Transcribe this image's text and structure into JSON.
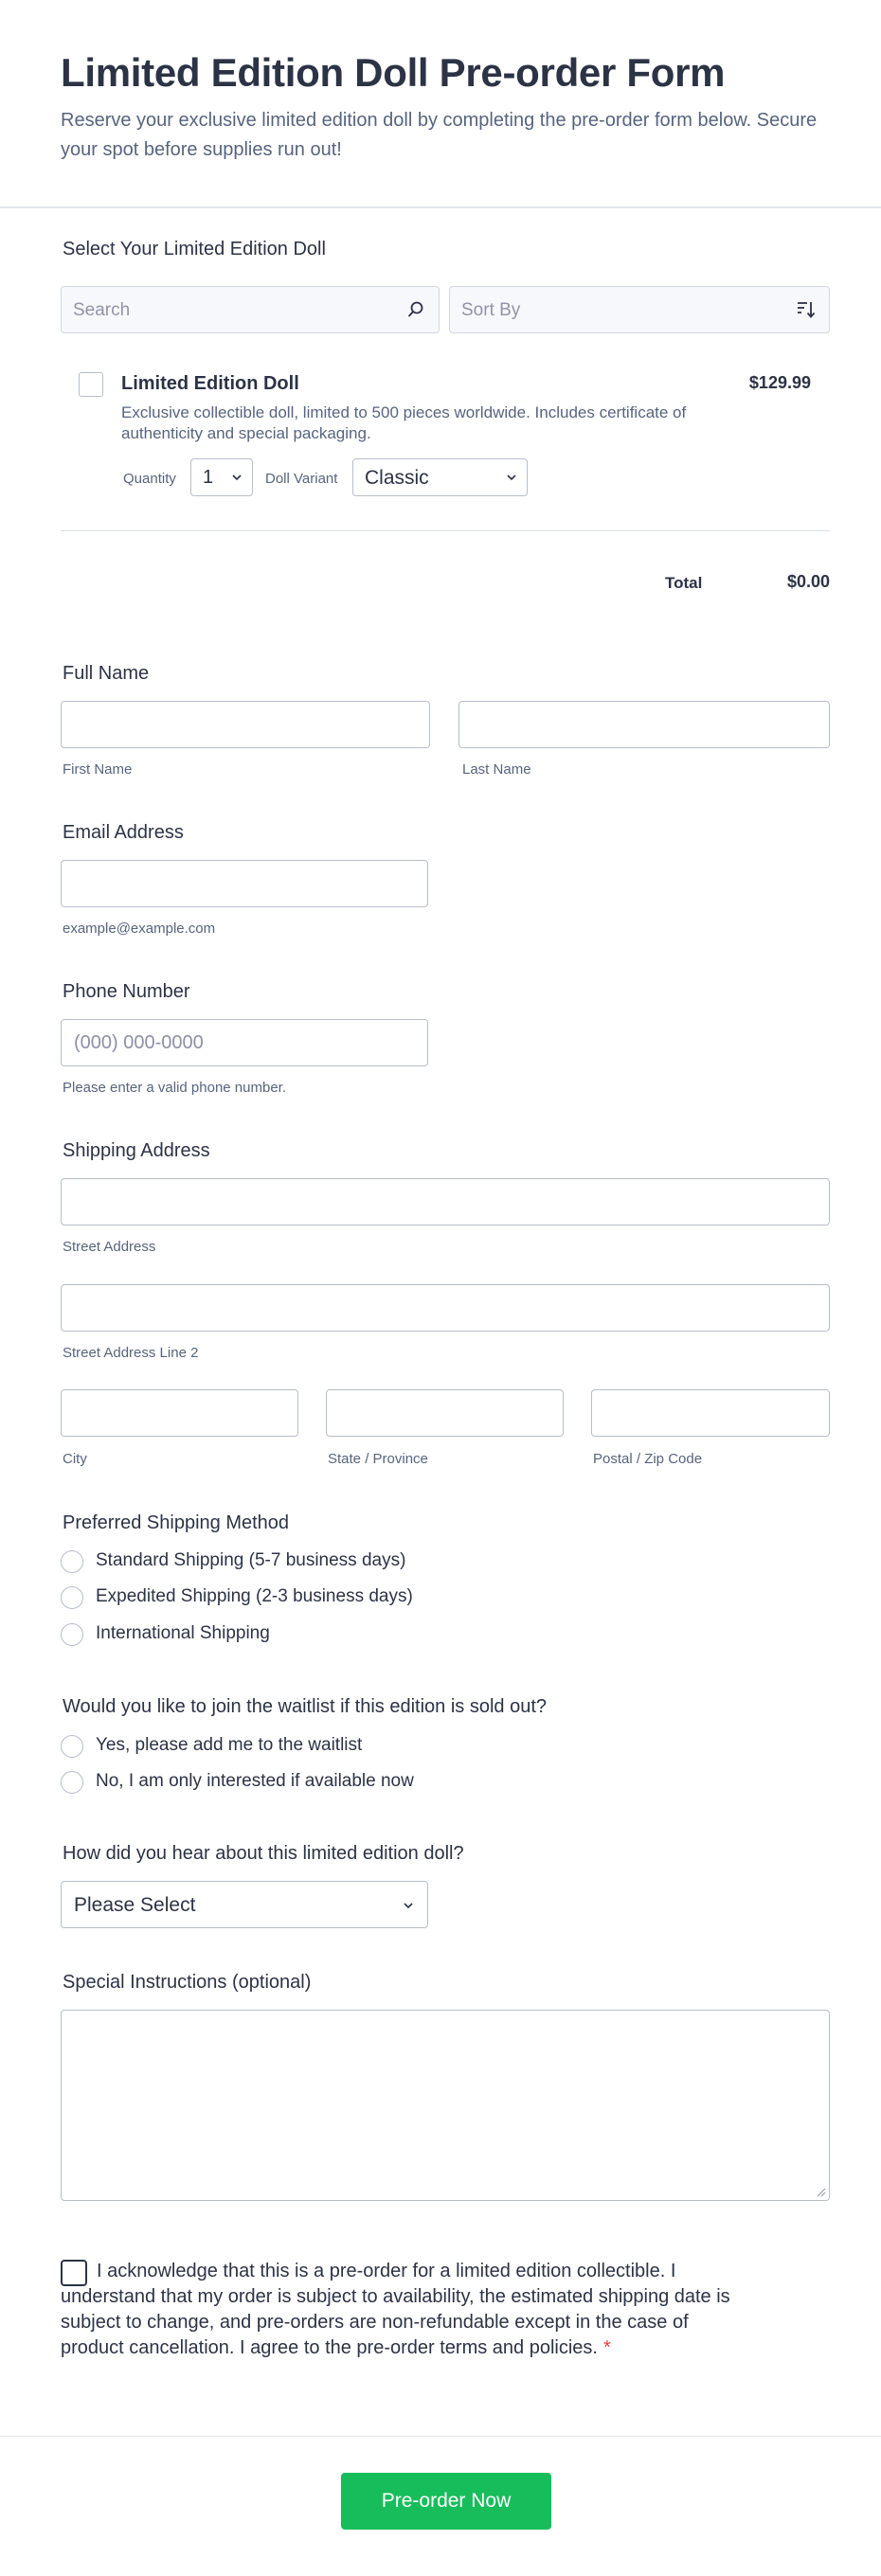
{
  "header": {
    "title": "Limited Edition Doll Pre-order Form",
    "subtitle": "Reserve your exclusive limited edition doll by completing the pre-order form below. Secure your spot before supplies run out!"
  },
  "products": {
    "label": "Select Your Limited Edition Doll",
    "search_placeholder": "Search",
    "sort_placeholder": "Sort By",
    "items": [
      {
        "name": "Limited Edition Doll",
        "price": "$129.99",
        "description": "Exclusive collectible doll, limited to 500 pieces worldwide. Includes certificate of authenticity and special packaging.",
        "quantity_label": "Quantity",
        "quantity_value": "1",
        "variant_label": "Doll Variant",
        "variant_value": "Classic"
      }
    ],
    "total_label": "Total",
    "total_value": "$0.00"
  },
  "full_name": {
    "label": "Full Name",
    "first_sublabel": "First Name",
    "last_sublabel": "Last Name"
  },
  "email": {
    "label": "Email Address",
    "sublabel": "example@example.com"
  },
  "phone": {
    "label": "Phone Number",
    "placeholder": "(000) 000-0000",
    "sublabel": "Please enter a valid phone number."
  },
  "address": {
    "label": "Shipping Address",
    "street_sublabel": "Street Address",
    "street2_sublabel": "Street Address Line 2",
    "city_sublabel": "City",
    "state_sublabel": "State / Province",
    "zip_sublabel": "Postal / Zip Code"
  },
  "shipping_method": {
    "label": "Preferred Shipping Method",
    "options": [
      "Standard Shipping (5-7 business days)",
      "Expedited Shipping (2-3 business days)",
      "International Shipping"
    ]
  },
  "waitlist": {
    "label": "Would you like to join the waitlist if this edition is sold out?",
    "options": [
      "Yes, please add me to the waitlist",
      "No, I am only interested if available now"
    ]
  },
  "referral": {
    "label": "How did you hear about this limited edition doll?",
    "value": "Please Select"
  },
  "instructions": {
    "label": "Special Instructions (optional)"
  },
  "acknowledgement": {
    "text": "I acknowledge that this is a pre-order for a limited edition collectible. I understand that my order is subject to availability, the estimated shipping date is subject to change, and pre-orders are non-refundable except in the case of product cancellation. I agree to the pre-order terms and policies.",
    "required_mark": "*"
  },
  "submit": {
    "label": "Pre-order Now"
  },
  "colors": {
    "accent": "#18bd5b",
    "text": "#2c3345",
    "muted": "#57647e",
    "border": "#b8bdc9",
    "required": "#f23a3c"
  }
}
